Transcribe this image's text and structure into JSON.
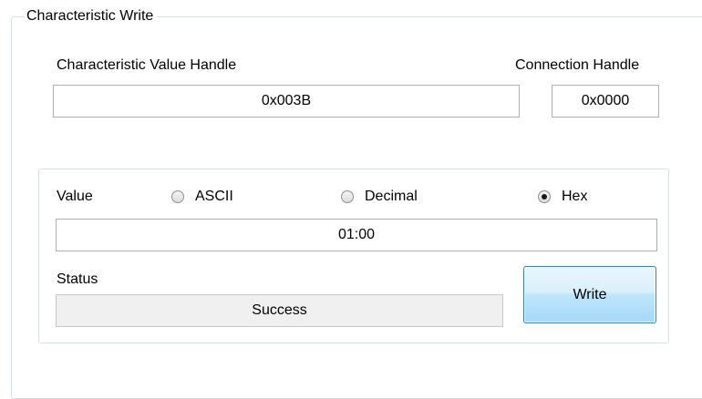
{
  "group": {
    "title": "Characteristic Write"
  },
  "handles": {
    "value_handle_label": "Characteristic Value Handle",
    "value_handle": "0x003B",
    "connection_handle_label": "Connection Handle",
    "connection_handle": "0x0000"
  },
  "value_panel": {
    "value_label": "Value",
    "format_options": [
      {
        "label": "ASCII",
        "checked": false
      },
      {
        "label": "Decimal",
        "checked": false
      },
      {
        "label": "Hex",
        "checked": true
      }
    ],
    "value": "01:00",
    "status_label": "Status",
    "status": "Success",
    "write_label": "Write"
  }
}
